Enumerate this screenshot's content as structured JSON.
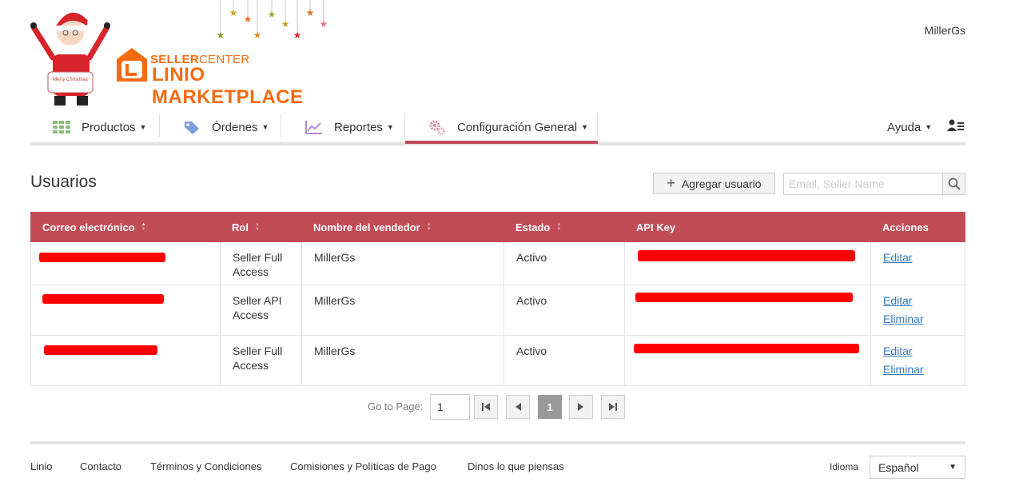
{
  "header": {
    "logo_seller": "SELLER",
    "logo_center": "CENTER",
    "logo_brand": "LINIO MARKETPLACE",
    "username": "MillerGs",
    "santa_sign": "Merry Christmas"
  },
  "nav": {
    "items": [
      {
        "label": "Productos",
        "icon": "grid-icon"
      },
      {
        "label": "Órdenes",
        "icon": "tag-icon"
      },
      {
        "label": "Reportes",
        "icon": "chart-icon"
      },
      {
        "label": "Configuración General",
        "icon": "gears-icon"
      }
    ],
    "active_index": 3,
    "help_label": "Ayuda",
    "user_menu_icon": "user-list-icon",
    "accent": "#c14c56"
  },
  "page": {
    "title": "Usuarios",
    "add_button": "Agregar usuario",
    "search_placeholder": "Email, Seller Name"
  },
  "table": {
    "headers": [
      "Correo electrónico",
      "Rol",
      "Nombre del vendedor",
      "Estado",
      "API Key",
      "Acciones"
    ],
    "rows": [
      {
        "role": "Seller Full Access",
        "seller": "MillerGs",
        "status": "Activo",
        "actions": [
          "Editar"
        ]
      },
      {
        "role": "Seller API Access",
        "seller": "MillerGs",
        "status": "Activo",
        "actions": [
          "Editar",
          "Eliminar"
        ]
      },
      {
        "role": "Seller Full Access",
        "seller": "MillerGs",
        "status": "Activo",
        "actions": [
          "Editar",
          "Eliminar"
        ]
      }
    ]
  },
  "pager": {
    "label": "Go to Page:",
    "value": "1",
    "current": "1"
  },
  "footer": {
    "links": [
      "Linio",
      "Contacto",
      "Términos y Condiciones",
      "Comisiones y Políticas de Pago",
      "Dinos lo que piensas"
    ],
    "language_label": "Idioma",
    "language_value": "Español"
  }
}
